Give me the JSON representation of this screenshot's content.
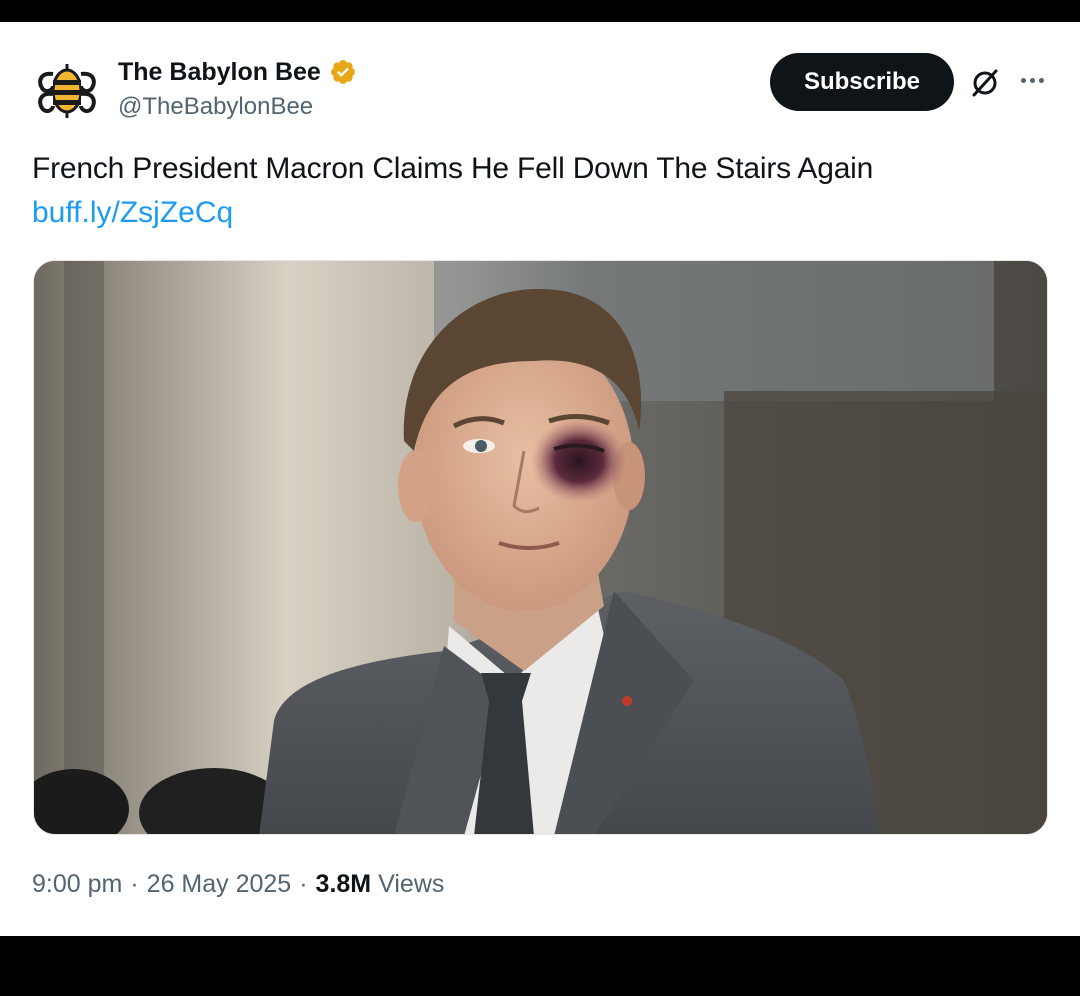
{
  "tweet": {
    "author": {
      "display_name": "The Babylon Bee",
      "handle": "@TheBabylonBee",
      "verified_badge_icon": "verified-badge-gold",
      "logo_icon": "babylon-bee-logo"
    },
    "subscribe_label": "Subscribe",
    "text": "French President Macron Claims He Fell Down The Stairs Again",
    "link": "buff.ly/ZsjZeCq",
    "image_alt": "Photo of a man in a grey suit with a black eye",
    "time": "9:00 pm",
    "separator": "·",
    "date": "26 May 2025",
    "views_count": "3.8M",
    "views_label": "Views"
  },
  "colors": {
    "text_primary": "#0f1419",
    "text_secondary": "#536471",
    "link": "#1d9bf0",
    "badge": "#e6a817",
    "logo": "#f2b531"
  },
  "icons": {
    "grok": "grok-icon",
    "more": "more-options-icon"
  }
}
